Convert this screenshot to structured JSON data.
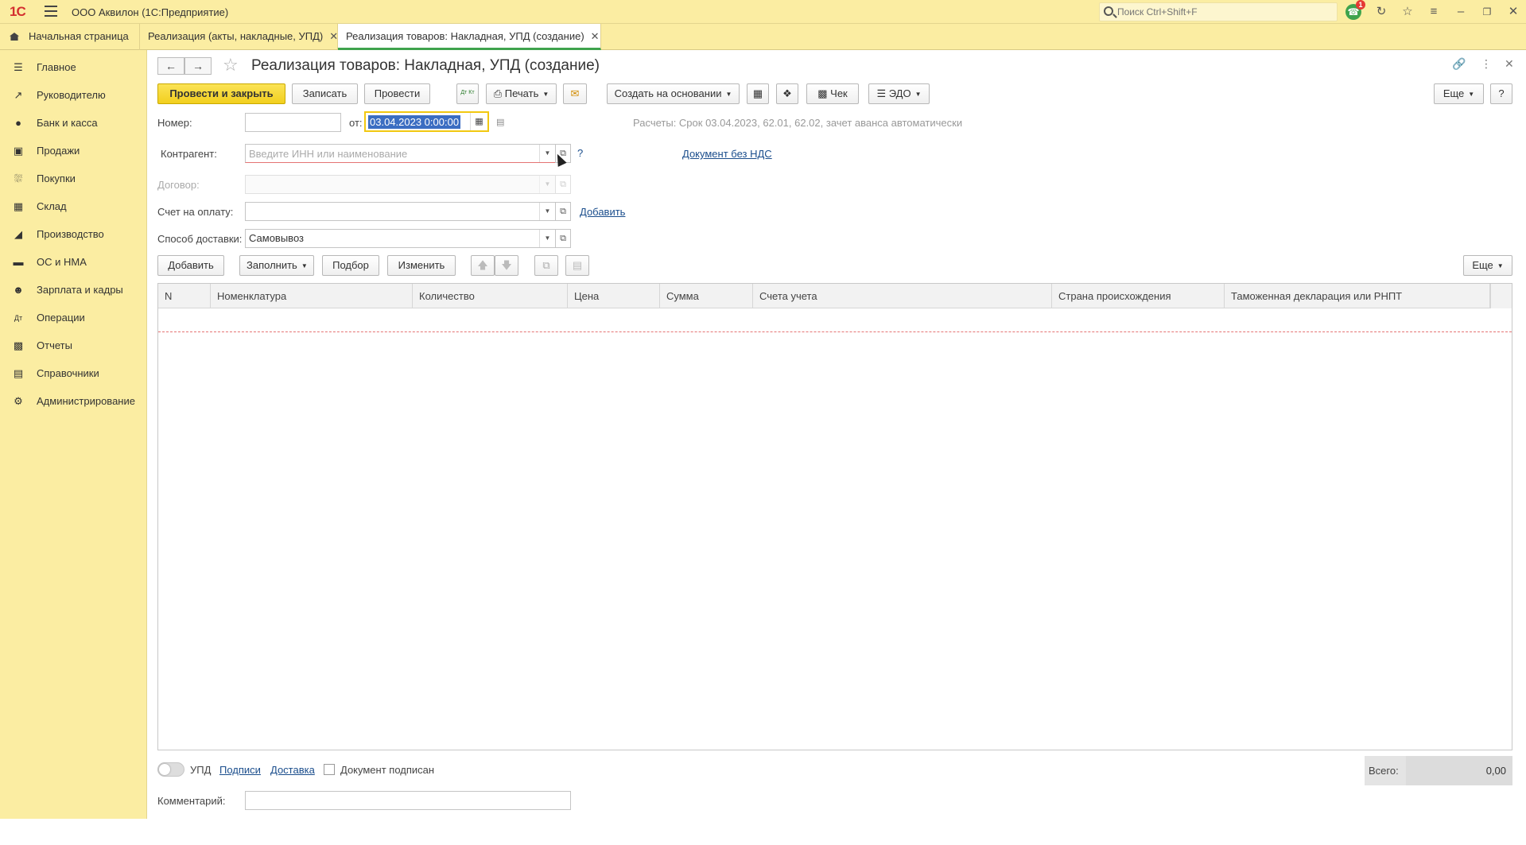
{
  "app": {
    "title": "ООО Аквилон  (1С:Предприятие)",
    "search_placeholder": "Поиск Ctrl+Shift+F",
    "notifications_count": "1"
  },
  "tabs": [
    {
      "label": "Начальная страница"
    },
    {
      "label": "Реализация (акты, накладные, УПД)"
    },
    {
      "label": "Реализация товаров: Накладная, УПД (создание)"
    }
  ],
  "sidebar": {
    "items": [
      {
        "label": "Главное",
        "icon": "menu-lines-icon"
      },
      {
        "label": "Руководителю",
        "icon": "trend-chart-icon"
      },
      {
        "label": "Банк и касса",
        "icon": "coin-icon"
      },
      {
        "label": "Продажи",
        "icon": "shopping-bag-icon"
      },
      {
        "label": "Покупки",
        "icon": "cart-icon"
      },
      {
        "label": "Склад",
        "icon": "warehouse-grid-icon"
      },
      {
        "label": "Производство",
        "icon": "factory-icon"
      },
      {
        "label": "ОС и НМА",
        "icon": "truck-icon"
      },
      {
        "label": "Зарплата и кадры",
        "icon": "person-icon"
      },
      {
        "label": "Операции",
        "icon": "debit-credit-icon"
      },
      {
        "label": "Отчеты",
        "icon": "bar-chart-icon"
      },
      {
        "label": "Справочники",
        "icon": "books-icon"
      },
      {
        "label": "Администрирование",
        "icon": "gear-icon"
      }
    ]
  },
  "document": {
    "title": "Реализация товаров: Накладная, УПД (создание)"
  },
  "toolbar": {
    "post_close": "Провести и закрыть",
    "save": "Записать",
    "post": "Провести",
    "dt_kt": "Дт Кт",
    "print": "Печать",
    "create_based": "Создать на основании",
    "check": "Чек",
    "edo": "ЭДО",
    "more": "Еще",
    "help": "?"
  },
  "form": {
    "number_label": "Номер:",
    "number_value": "",
    "from_label": "от:",
    "date_value": "03.04.2023  0:00:00",
    "settlements_text": "Расчеты: Срок 03.04.2023, 62.01, 62.02, зачет аванса автоматически",
    "counterparty_label": "Контрагент:",
    "counterparty_placeholder": "Введите ИНН или наименование",
    "counterparty_help": "?",
    "no_vat_link": "Документ без НДС",
    "contract_label": "Договор:",
    "invoice_label": "Счет на оплату:",
    "invoice_add_link": "Добавить",
    "delivery_label": "Способ доставки:",
    "delivery_value": "Самовывоз"
  },
  "table_toolbar": {
    "add": "Добавить",
    "fill": "Заполнить",
    "pick": "Подбор",
    "change": "Изменить",
    "more": "Еще"
  },
  "table": {
    "columns": [
      "N",
      "Номенклатура",
      "Количество",
      "Цена",
      "Сумма",
      "Счета учета",
      "Страна происхождения",
      "Таможенная декларация или РНПТ"
    ],
    "rows": []
  },
  "footer": {
    "upd_label": "УПД",
    "signatures_link": "Подписи",
    "delivery_link": "Доставка",
    "signed_label": "Документ подписан",
    "total_label": "Всего:",
    "total_value": "0,00",
    "comment_label": "Комментарий:",
    "comment_value": ""
  }
}
